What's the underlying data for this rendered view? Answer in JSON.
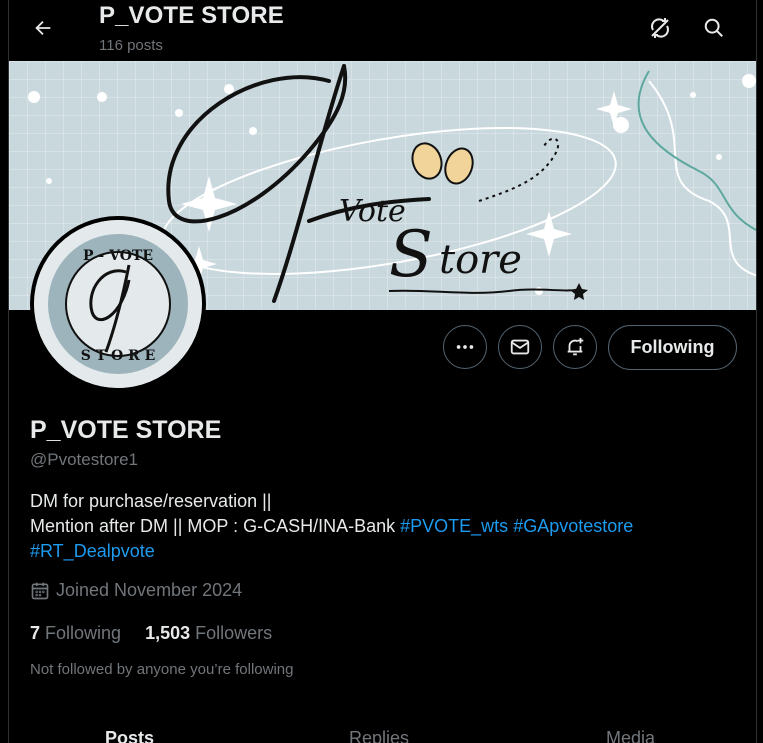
{
  "header": {
    "title": "P_VOTE STORE",
    "post_count": "116 posts",
    "back_icon": "arrow-left-icon",
    "sync_icon": "no-sync-icon",
    "search_icon": "search-icon"
  },
  "profile": {
    "name": "P_VOTE STORE",
    "handle": "@Pvotestore1",
    "bio_line1": "DM for purchase/reservation ||",
    "bio_line2_text": "Mention after DM || MOP : G-CASH/INA-Bank ",
    "bio_tag1": "#PVOTE_wts",
    "bio_tag2": "#GApvotestore",
    "bio_tag3": "#RT_Dealpvote",
    "joined": "Joined November 2024",
    "following_count": "7",
    "following_label": "Following",
    "followers_count": "1,503",
    "followers_label": "Followers",
    "not_followed": "Not followed by anyone you’re following"
  },
  "actions": {
    "following_button": "Following"
  },
  "tabs": [
    {
      "label": "Posts",
      "active": true
    },
    {
      "label": "Replies",
      "active": false
    },
    {
      "label": "Media",
      "active": false
    }
  ],
  "colors": {
    "background": "#000000",
    "text": "#e7e9ea",
    "secondary": "#71767b",
    "link": "#1d9bf0",
    "border": "#536471",
    "banner": "#c9d8dd"
  }
}
